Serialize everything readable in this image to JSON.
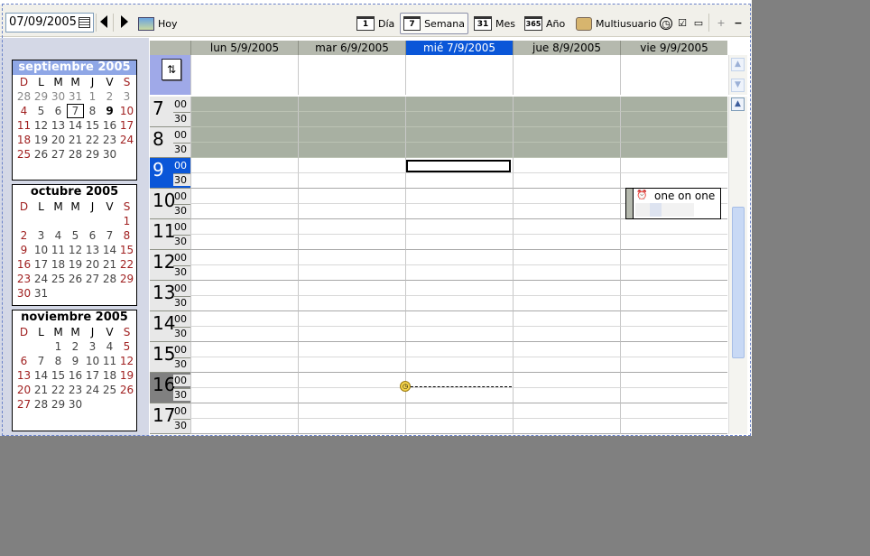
{
  "toolbar": {
    "date_value": "07/09/2005",
    "hoy_label": "Hoy",
    "views": [
      {
        "icon_text": "1",
        "label": "Día"
      },
      {
        "icon_text": "7",
        "label": "Semana"
      },
      {
        "icon_text": "31",
        "label": "Mes"
      },
      {
        "icon_text": "365",
        "label": "Año"
      }
    ],
    "multiuser_label": "Multiusuario",
    "plus_label": "+",
    "minus_label": "−"
  },
  "mini_calendars": [
    {
      "title": "septiembre 2005"
    },
    {
      "title": "octubre 2005"
    },
    {
      "title": "noviembre 2005"
    }
  ],
  "weekday_letters": [
    "D",
    "L",
    "M",
    "M",
    "J",
    "V",
    "S"
  ],
  "week_days": [
    "lun 5/9/2005",
    "mar 6/9/2005",
    "mié 7/9/2005",
    "jue 8/9/2005",
    "vie 9/9/2005"
  ],
  "hours": [
    "7",
    "8",
    "9",
    "10",
    "11",
    "12",
    "13",
    "14",
    "15",
    "16",
    "17"
  ],
  "minute_labels": [
    "00",
    "30"
  ],
  "event": {
    "title": "one on one",
    "icon": "alarm-icon"
  },
  "allday_button": "⇅",
  "colors": {
    "today": "#0a56d8",
    "offhours": "#a8b0a2",
    "minical_header": "#8fa7e6"
  }
}
